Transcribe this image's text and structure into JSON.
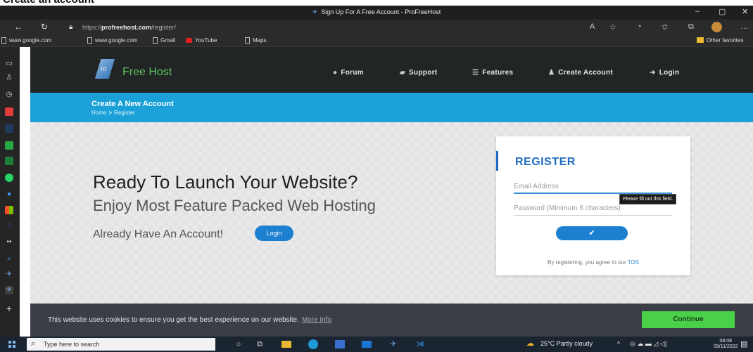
{
  "window": {
    "title": "Sign Up For A Free Account - ProFreeHost",
    "controls": {
      "minimize": "–",
      "maximize": "▢",
      "close": "✕"
    }
  },
  "address_bar": {
    "url_prefix": "https://",
    "url_host": "profreehost.com",
    "url_path": "/register/"
  },
  "bookmarks": [
    {
      "label": "www.google.com"
    },
    {
      "label": "www.google.com"
    },
    {
      "label": "Gmail"
    },
    {
      "label": "YouTube"
    },
    {
      "label": "Maps"
    }
  ],
  "bookmarks_other": "Other favorites",
  "site": {
    "logo_text": "Free Host",
    "logo_mark": "ro",
    "nav": [
      {
        "label": "Forum",
        "icon": "chat-icon"
      },
      {
        "label": "Support",
        "icon": "ticket-icon"
      },
      {
        "label": "Features",
        "icon": "list-icon"
      },
      {
        "label": "Create Account",
        "icon": "users-icon"
      },
      {
        "label": "Login",
        "icon": "signin-icon"
      }
    ]
  },
  "band": {
    "heading": "Create A New Account",
    "crumb_home": "Home",
    "crumb_sep": ">",
    "crumb_current": "Register"
  },
  "hero": {
    "title": "Ready To Launch Your Website?",
    "subtitle": "Enjoy Most Feature Packed Web Hosting",
    "already": "Already Have An Account!",
    "login_button": "Login"
  },
  "register": {
    "heading": "REGISTER",
    "email_placeholder": "Email Address",
    "password_placeholder": "Password (Minimum 6 characters)",
    "tooltip": "Please fill out this field.",
    "submit_icon": "✔",
    "tos_text": "By registering, you agree to our",
    "tos_link": "TOS"
  },
  "cookie": {
    "message": "This website uses cookies to ensure you get the best experience on our website.",
    "more_info": "More Info",
    "continue": "Continue"
  },
  "taskbar": {
    "search_placeholder": "Type here to search",
    "weather": "25°C Partly cloudy",
    "time": "08:08",
    "date": "09/11/2022"
  },
  "colors": {
    "header_bg": "#222526",
    "brand_green": "#5ec35e",
    "band_blue": "#1ba1d8",
    "primary_blue": "#1d7fd0",
    "continue_green": "#4ad14a",
    "cookie_bg": "#3b3e46"
  }
}
